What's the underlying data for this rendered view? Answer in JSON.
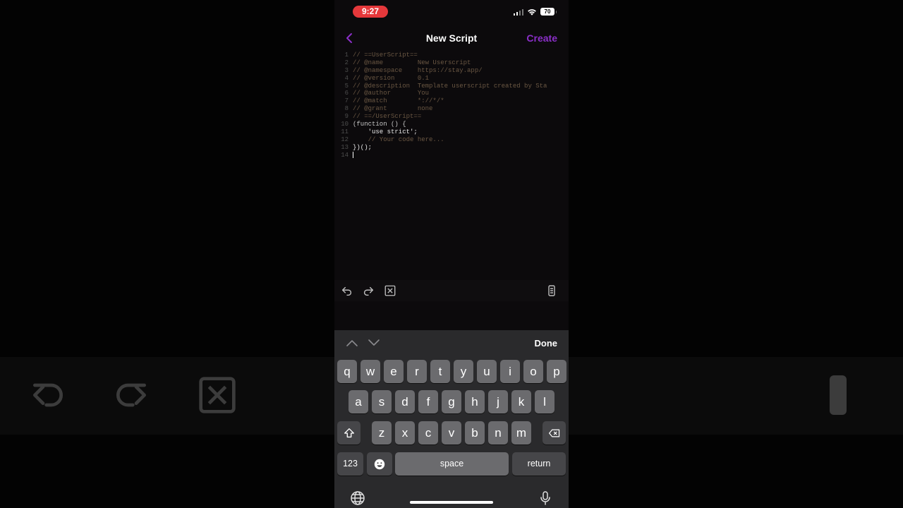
{
  "status_bar": {
    "time": "9:27",
    "battery": "70"
  },
  "nav": {
    "title": "New Script",
    "create_label": "Create"
  },
  "editor": {
    "lines": [
      {
        "num": "1",
        "text": "// ==UserScript=="
      },
      {
        "num": "2",
        "text": "// @name         New Userscript"
      },
      {
        "num": "3",
        "text": "// @namespace    https://stay.app/"
      },
      {
        "num": "4",
        "text": "// @version      0.1"
      },
      {
        "num": "5",
        "text": "// @description  Template userscript created by Sta"
      },
      {
        "num": "6",
        "text": "// @author       You"
      },
      {
        "num": "7",
        "text": "// @match        *://*/*"
      },
      {
        "num": "8",
        "text": "// @grant        none"
      },
      {
        "num": "9",
        "text": "// ==/UserScript=="
      },
      {
        "num": "10",
        "text": "(function () {"
      },
      {
        "num": "11",
        "text": "    'use strict';"
      },
      {
        "num": "12",
        "text": "    // Your code here..."
      },
      {
        "num": "13",
        "text": "})();"
      },
      {
        "num": "14",
        "text": ""
      }
    ]
  },
  "keyboard": {
    "done_label": "Done",
    "row1": [
      "q",
      "w",
      "e",
      "r",
      "t",
      "y",
      "u",
      "i",
      "o",
      "p"
    ],
    "row2": [
      "a",
      "s",
      "d",
      "f",
      "g",
      "h",
      "j",
      "k",
      "l"
    ],
    "row3": [
      "z",
      "x",
      "c",
      "v",
      "b",
      "n",
      "m"
    ],
    "numbers_label": "123",
    "space_label": "space",
    "return_label": "return"
  },
  "icons": {
    "back": "chevron-left-icon",
    "undo": "undo-icon",
    "redo": "redo-icon",
    "clear": "clear-icon",
    "keyboard": "keyboard-icon",
    "globe": "globe-icon",
    "mic": "microphone-icon"
  },
  "colors": {
    "accent": "#8b2fc9",
    "time_pill": "#e5383b",
    "comment": "#6a5743"
  }
}
